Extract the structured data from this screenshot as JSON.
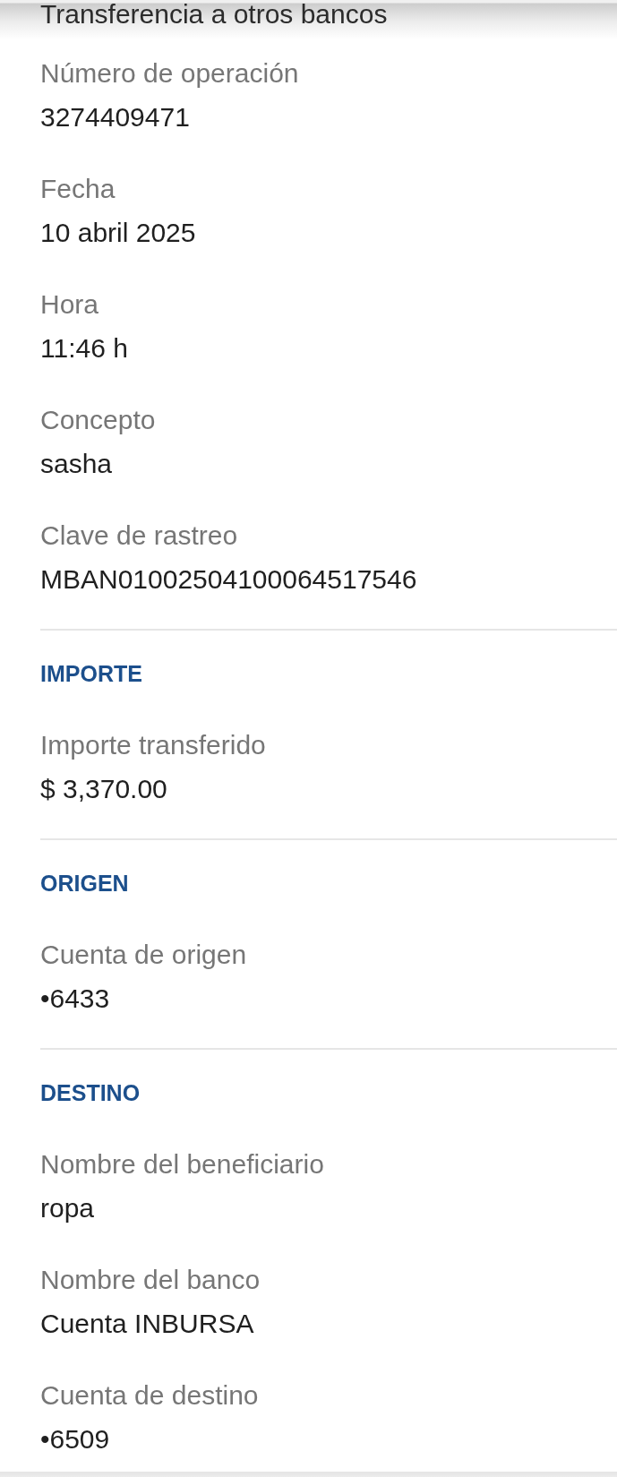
{
  "header": {
    "title": "Transferencia a otros bancos"
  },
  "details": [
    {
      "label": "Número de operación",
      "value": "3274409471"
    },
    {
      "label": "Fecha",
      "value": "10 abril 2025"
    },
    {
      "label": "Hora",
      "value": "11:46 h"
    },
    {
      "label": "Concepto",
      "value": "sasha"
    },
    {
      "label": "Clave de rastreo",
      "value": "MBAN01002504100064517546"
    }
  ],
  "sections": [
    {
      "heading": "IMPORTE",
      "fields": [
        {
          "label": "Importe transferido",
          "value": "$ 3,370.00"
        }
      ]
    },
    {
      "heading": "ORIGEN",
      "fields": [
        {
          "label": "Cuenta de origen",
          "value": "•6433"
        }
      ]
    },
    {
      "heading": "DESTINO",
      "fields": [
        {
          "label": "Nombre del beneficiario",
          "value": "ropa"
        },
        {
          "label": "Nombre del banco",
          "value": "Cuenta INBURSA"
        },
        {
          "label": "Cuenta de destino",
          "value": "•6509"
        }
      ]
    }
  ]
}
